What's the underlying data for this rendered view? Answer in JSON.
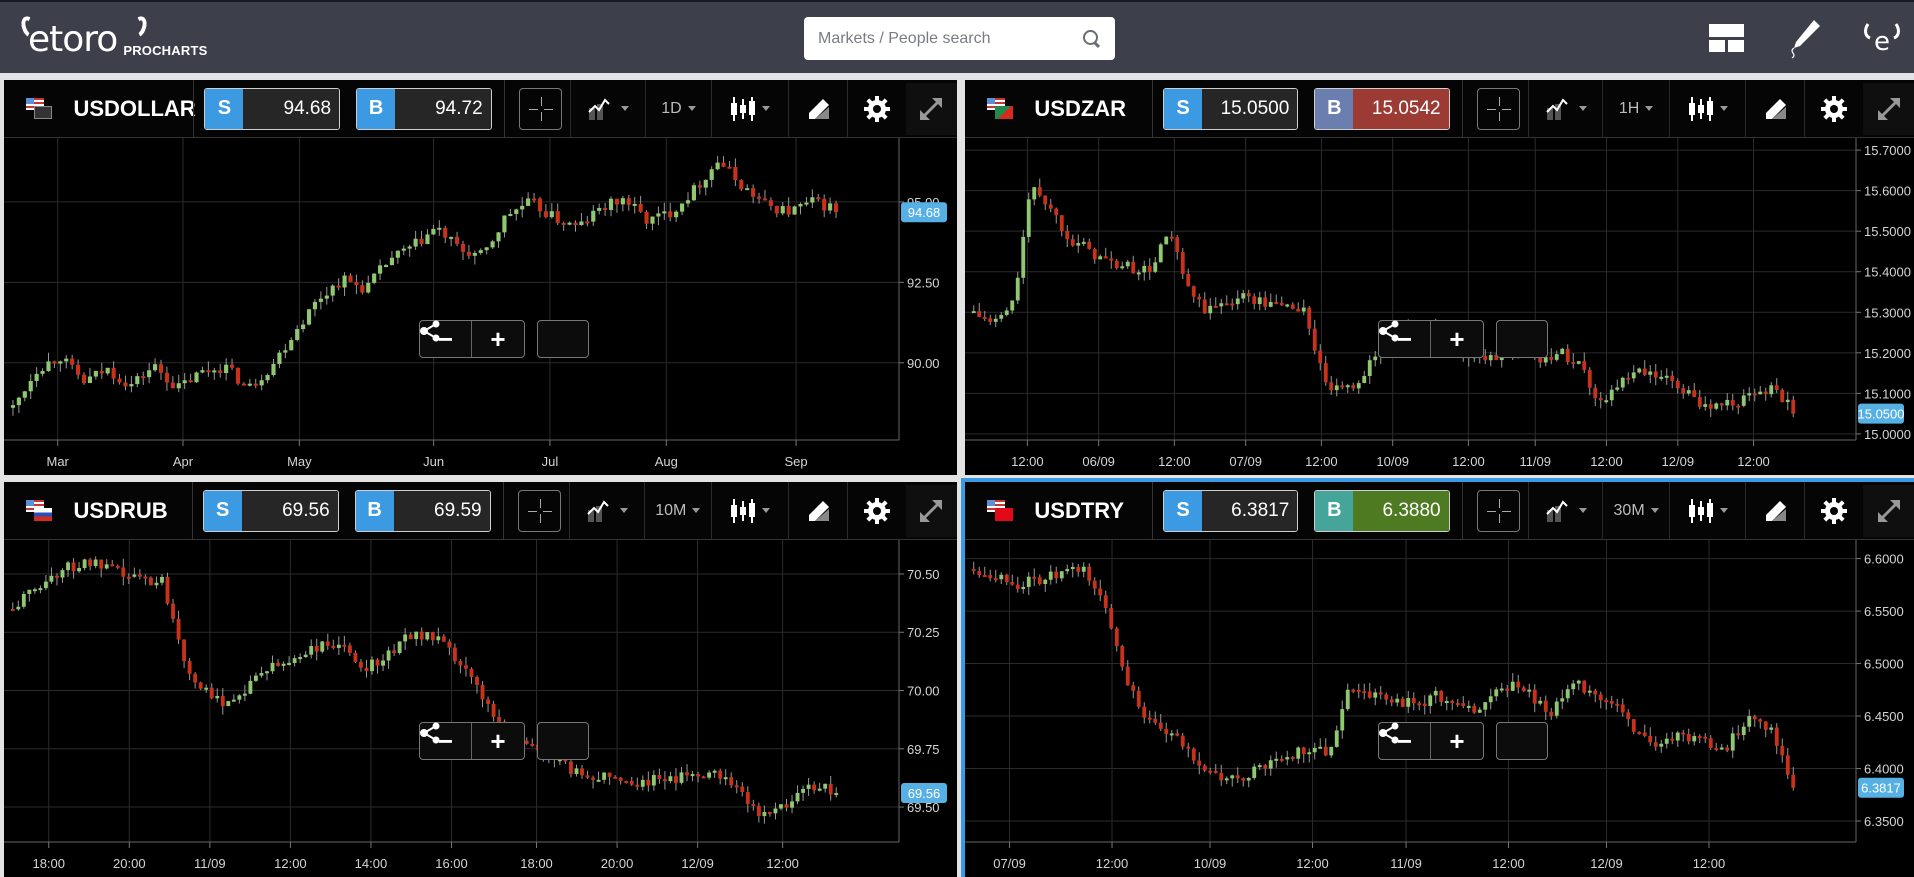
{
  "header": {
    "logo_text": "etoro",
    "logo_sub": "PROCHARTS",
    "search_placeholder": "Markets / People search",
    "icons": [
      "layout-icon",
      "pencil-icon",
      "user-profile-icon"
    ]
  },
  "colors": {
    "accent": "#3b9ae1",
    "bullish": "#8fc870",
    "bearish": "#c8321a",
    "wick": "#9a9a9a",
    "current_price_label": "#56b0e3"
  },
  "panels": [
    {
      "symbol": "USDOLLAR",
      "flag": "usa-flag",
      "sell_label": "S",
      "sell": "94.68",
      "buy_label": "B",
      "buy": "94.72",
      "buy_style": "neutral",
      "timeframe": "1D",
      "active": false,
      "chart_data": {
        "type": "candlestick",
        "y_ticks": [
          "95.00",
          "92.50",
          "90.00"
        ],
        "y_tick_values": [
          95.0,
          92.5,
          90.0
        ],
        "ylim": [
          87.6,
          96.8
        ],
        "x_ticks": [
          "Mar",
          "Apr",
          "May",
          "Jun",
          "Jul",
          "Aug",
          "Sep"
        ],
        "x_tick_positions": [
          0.06,
          0.2,
          0.33,
          0.48,
          0.61,
          0.74,
          0.885
        ],
        "current_price": 94.68,
        "candle_count": 140,
        "path": [
          88.6,
          89.8,
          90.2,
          89.4,
          89.8,
          89.3,
          89.9,
          89.2,
          89.7,
          89.9,
          89.2,
          89.9,
          91.0,
          92.0,
          92.6,
          92.3,
          93.2,
          93.6,
          94.2,
          93.5,
          93.3,
          94.6,
          95.0,
          94.5,
          94.2,
          94.8,
          95.1,
          94.4,
          94.7,
          95.4,
          96.3,
          95.5,
          94.9,
          94.7,
          95.0,
          94.8
        ]
      }
    },
    {
      "symbol": "USDZAR",
      "flag": "usa-zaf-flag",
      "sell_label": "S",
      "sell": "15.0500",
      "buy_label": "B",
      "buy": "15.0542",
      "buy_style": "down",
      "timeframe": "1H",
      "active": false,
      "chart_data": {
        "type": "candlestick",
        "y_ticks": [
          "15.7000",
          "15.6000",
          "15.5000",
          "15.4000",
          "15.3000",
          "15.2000",
          "15.1000",
          "15.0000"
        ],
        "y_tick_values": [
          15.7,
          15.6,
          15.5,
          15.4,
          15.3,
          15.2,
          15.1,
          15.0
        ],
        "ylim": [
          14.985,
          15.715
        ],
        "x_ticks": [
          "12:00",
          "06/09",
          "12:00",
          "07/09",
          "12:00",
          "10/09",
          "12:00",
          "11/09",
          "12:00",
          "12/09",
          "12:00"
        ],
        "x_tick_positions": [
          0.07,
          0.15,
          0.235,
          0.315,
          0.4,
          0.48,
          0.565,
          0.64,
          0.72,
          0.8,
          0.885
        ],
        "current_price": 15.05,
        "candle_count": 150,
        "path": [
          15.3,
          15.27,
          15.32,
          15.62,
          15.55,
          15.48,
          15.45,
          15.42,
          15.41,
          15.4,
          15.5,
          15.35,
          15.3,
          15.33,
          15.34,
          15.32,
          15.32,
          15.3,
          15.12,
          15.1,
          15.15,
          15.22,
          15.25,
          15.26,
          15.25,
          15.2,
          15.18,
          15.2,
          15.21,
          15.19,
          15.2,
          15.18,
          15.08,
          15.12,
          15.15,
          15.14,
          15.12,
          15.08,
          15.07,
          15.08,
          15.09,
          15.12,
          15.05
        ]
      }
    },
    {
      "symbol": "USDRUB",
      "flag": "usa-rus-flag",
      "sell_label": "S",
      "sell": "69.56",
      "buy_label": "B",
      "buy": "69.59",
      "buy_style": "neutral",
      "timeframe": "10M",
      "active": false,
      "chart_data": {
        "type": "candlestick",
        "y_ticks": [
          "70.50",
          "70.25",
          "70.00",
          "69.75",
          "69.50"
        ],
        "y_tick_values": [
          70.5,
          70.25,
          70.0,
          69.75,
          69.5
        ],
        "ylim": [
          69.35,
          70.62
        ],
        "x_ticks": [
          "18:00",
          "20:00",
          "11/09",
          "12:00",
          "14:00",
          "16:00",
          "18:00",
          "20:00",
          "12/09",
          "12:00"
        ],
        "x_tick_positions": [
          0.05,
          0.14,
          0.23,
          0.32,
          0.41,
          0.5,
          0.595,
          0.685,
          0.775,
          0.87
        ],
        "current_price": 69.56,
        "candle_count": 150,
        "path": [
          70.35,
          70.45,
          70.52,
          70.55,
          70.51,
          70.48,
          70.47,
          70.1,
          69.95,
          69.97,
          70.08,
          70.12,
          70.18,
          70.2,
          70.1,
          70.15,
          70.25,
          70.22,
          70.1,
          69.95,
          69.8,
          69.75,
          69.68,
          69.63,
          69.64,
          69.6,
          69.62,
          69.63,
          69.66,
          69.6,
          69.45,
          69.52,
          69.6,
          69.56
        ]
      }
    },
    {
      "symbol": "USDTRY",
      "flag": "usa-tur-flag",
      "sell_label": "S",
      "sell": "6.3817",
      "buy_label": "B",
      "buy": "6.3880",
      "buy_style": "up",
      "timeframe": "30M",
      "active": true,
      "chart_data": {
        "type": "candlestick",
        "y_ticks": [
          "6.6000",
          "6.5500",
          "6.5000",
          "6.4500",
          "6.4000",
          "6.3500"
        ],
        "y_tick_values": [
          6.6,
          6.55,
          6.5,
          6.45,
          6.4,
          6.35
        ],
        "ylim": [
          6.33,
          6.612
        ],
        "x_ticks": [
          "07/09",
          "12:00",
          "10/09",
          "12:00",
          "11/09",
          "12:00",
          "12/09",
          "12:00"
        ],
        "x_tick_positions": [
          0.05,
          0.165,
          0.275,
          0.39,
          0.495,
          0.61,
          0.72,
          0.835
        ],
        "current_price": 6.3817,
        "candle_count": 150,
        "path": [
          6.59,
          6.585,
          6.575,
          6.58,
          6.585,
          6.59,
          6.55,
          6.48,
          6.44,
          6.43,
          6.41,
          6.39,
          6.39,
          6.4,
          6.41,
          6.42,
          6.415,
          6.48,
          6.47,
          6.465,
          6.46,
          6.47,
          6.455,
          6.46,
          6.48,
          6.475,
          6.45,
          6.48,
          6.475,
          6.46,
          6.43,
          6.425,
          6.43,
          6.425,
          6.42,
          6.45,
          6.44,
          6.38
        ]
      }
    }
  ],
  "chart_controls": {
    "zoom_out": "−",
    "zoom_in": "+",
    "share": "share-icon"
  }
}
